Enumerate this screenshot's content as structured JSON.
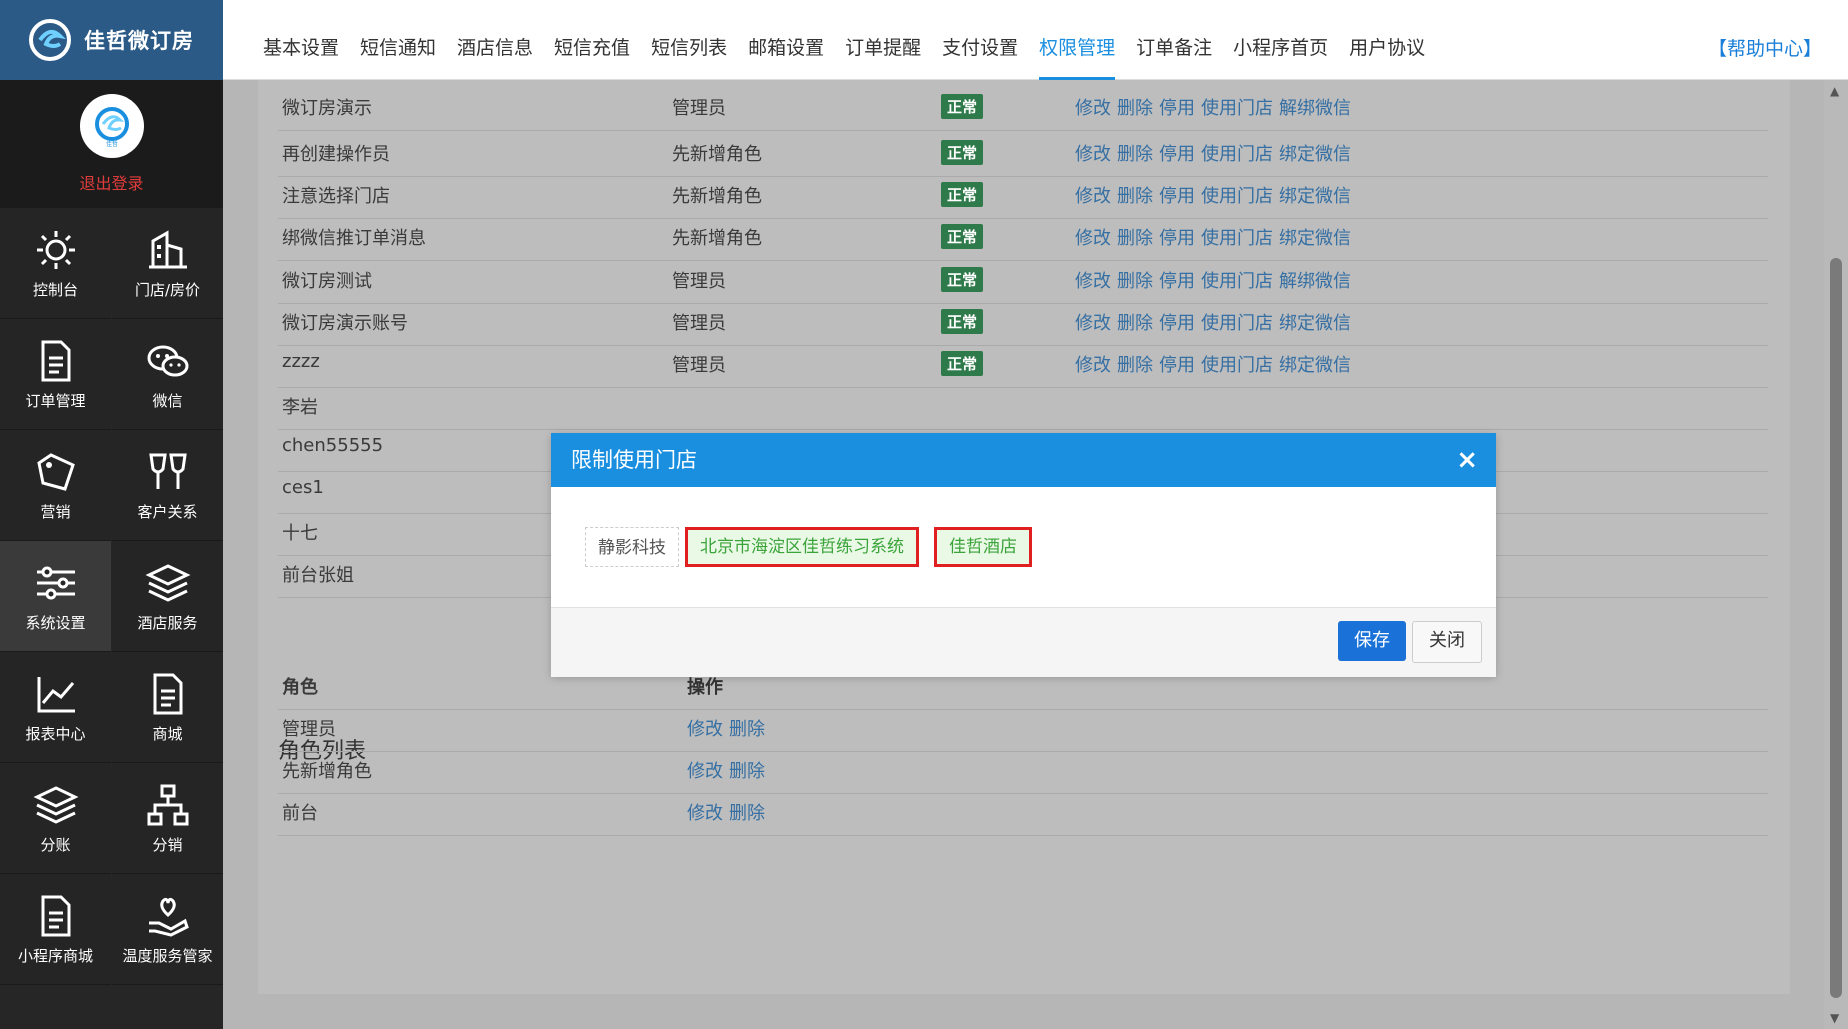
{
  "brand": {
    "name": "佳哲微订房"
  },
  "user": {
    "logout": "退出登录",
    "avatar_caption": "佳哲"
  },
  "sidebar": {
    "items": [
      {
        "label": "控制台",
        "icon": "gear-icon"
      },
      {
        "label": "门店/房价",
        "icon": "building-icon"
      },
      {
        "label": "订单管理",
        "icon": "document-icon"
      },
      {
        "label": "微信",
        "icon": "wechat-icon"
      },
      {
        "label": "营销",
        "icon": "tag-icon"
      },
      {
        "label": "客户关系",
        "icon": "glasses-icon"
      },
      {
        "label": "系统设置",
        "icon": "sliders-icon",
        "active": true
      },
      {
        "label": "酒店服务",
        "icon": "layers-icon"
      },
      {
        "label": "报表中心",
        "icon": "chart-icon"
      },
      {
        "label": "商城",
        "icon": "document-icon"
      },
      {
        "label": "分账",
        "icon": "layers-icon"
      },
      {
        "label": "分销",
        "icon": "network-icon"
      },
      {
        "label": "小程序商城",
        "icon": "document-icon"
      },
      {
        "label": "温度服务管家",
        "icon": "heart-hand-icon"
      }
    ]
  },
  "tabs": [
    "基本设置",
    "短信通知",
    "酒店信息",
    "短信充值",
    "短信列表",
    "邮箱设置",
    "订单提醒",
    "支付设置",
    "权限管理",
    "订单备注",
    "小程序首页",
    "用户协议"
  ],
  "active_tab": "权限管理",
  "help": "【帮助中心】",
  "operators": [
    {
      "name": "微订房演示",
      "role": "管理员",
      "status": "正常",
      "ops": [
        "修改",
        "删除",
        "停用",
        "使用门店",
        "解绑微信"
      ]
    },
    {
      "name": "再创建操作员",
      "role": "先新增角色",
      "status": "正常",
      "ops": [
        "修改",
        "删除",
        "停用",
        "使用门店",
        "绑定微信"
      ]
    },
    {
      "name": "注意选择门店",
      "role": "先新增角色",
      "status": "正常",
      "ops": [
        "修改",
        "删除",
        "停用",
        "使用门店",
        "绑定微信"
      ]
    },
    {
      "name": "绑微信推订单消息",
      "role": "先新增角色",
      "status": "正常",
      "ops": [
        "修改",
        "删除",
        "停用",
        "使用门店",
        "绑定微信"
      ]
    },
    {
      "name": "微订房测试",
      "role": "管理员",
      "status": "正常",
      "ops": [
        "修改",
        "删除",
        "停用",
        "使用门店",
        "解绑微信"
      ]
    },
    {
      "name": "微订房演示账号",
      "role": "管理员",
      "status": "正常",
      "ops": [
        "修改",
        "删除",
        "停用",
        "使用门店",
        "绑定微信"
      ]
    },
    {
      "name": "zzzz",
      "role": "管理员",
      "status": "正常",
      "ops": [
        "修改",
        "删除",
        "停用",
        "使用门店",
        "绑定微信"
      ]
    },
    {
      "name": "李岩"
    },
    {
      "name": "chen55555"
    },
    {
      "name": "ces1"
    },
    {
      "name": "十七"
    },
    {
      "name": "前台张姐"
    }
  ],
  "roles_section": {
    "title": "角色列表",
    "headers": [
      "角色",
      "操作"
    ],
    "rows": [
      {
        "role": "管理员",
        "ops": [
          "修改",
          "删除"
        ]
      },
      {
        "role": "先新增角色",
        "ops": [
          "修改",
          "删除"
        ]
      },
      {
        "role": "前台",
        "ops": [
          "修改",
          "删除"
        ]
      }
    ]
  },
  "modal": {
    "title": "限制使用门店",
    "close": "×",
    "stores": [
      {
        "name": "静影科技",
        "selected": false
      },
      {
        "name": "北京市海淀区佳哲练习系统",
        "selected": true
      },
      {
        "name": "佳哲酒店",
        "selected": true
      }
    ],
    "save": "保存",
    "cancel": "关闭"
  },
  "colors": {
    "accent": "#1a8fe0",
    "status_green": "#2f7a4a",
    "link": "#356fa3",
    "danger": "#e02020"
  }
}
